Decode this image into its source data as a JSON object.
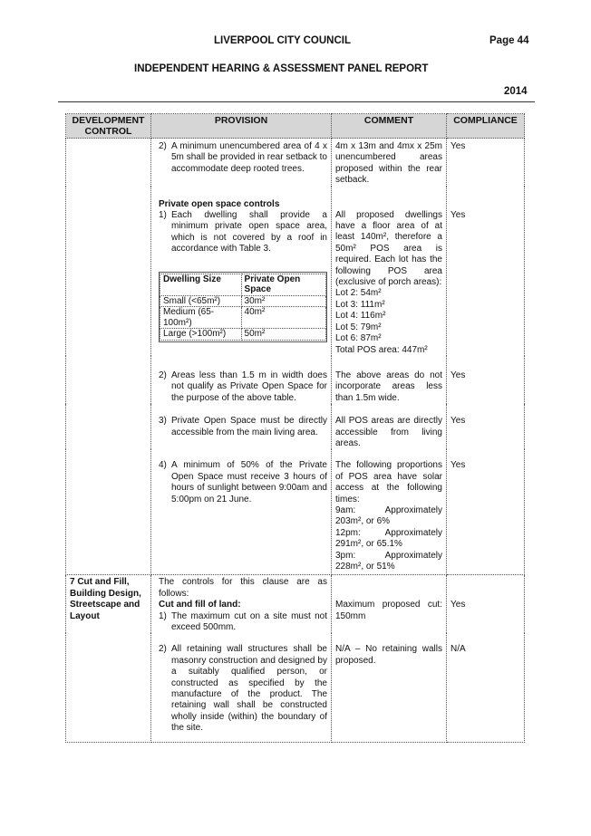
{
  "header": {
    "council": "LIVERPOOL CITY COUNCIL",
    "page": "Page 44",
    "report_title": "INDEPENDENT HEARING & ASSESSMENT PANEL REPORT",
    "year": "2014"
  },
  "table": {
    "headers": [
      "DEVELOPMENT CONTROL",
      "PROVISION",
      "COMMENT",
      "COMPLIANCE"
    ],
    "rows": {
      "r1": {
        "num": "2)",
        "provision": "A minimum unencumbered area of 4 x 5m shall be provided in rear setback to accommodate deep rooted trees.",
        "comment": "4m x 13m and 4mx x 25m unencumbered areas proposed within the rear setback.",
        "compliance": "Yes"
      },
      "r2": {
        "heading": "Private open space controls",
        "num": "1)",
        "provision": "Each dwelling shall provide a minimum private open space area, which is not covered by a roof in accordance with Table 3.",
        "comment_main": "All proposed dwellings have a floor area of at least 140m², therefore a 50m² POS area is required. Each lot has the following POS area (exclusive of porch areas):",
        "lots": [
          "Lot 2: 54m²",
          "Lot 3: 111m²",
          "Lot 4: 116m²",
          "Lot 5: 79m²",
          "Lot 6: 87m²",
          "Total POS area: 447m²"
        ],
        "compliance": "Yes",
        "pos_table": {
          "col1": "Dwelling Size",
          "col2": "Private Open Space",
          "rows": [
            {
              "size": "Small (<65m²)",
              "space": "30m²"
            },
            {
              "size": "Medium (65-100m²)",
              "space": "40m²"
            },
            {
              "size": "Large (>100m²)",
              "space": "50m²"
            }
          ]
        }
      },
      "r3": {
        "num": "2)",
        "provision": "Areas less than 1.5 m in width does not qualify as Private Open Space for the purpose of the above table.",
        "comment": "The above areas do not incorporate areas less than 1.5m wide.",
        "compliance": "Yes"
      },
      "r4": {
        "num": "3)",
        "provision": "Private Open Space must be directly accessible from the main living area.",
        "comment": "All POS areas are directly accessible from living areas.",
        "compliance": "Yes"
      },
      "r5": {
        "num": "4)",
        "provision": "A minimum of 50% of the Private Open Space must receive 3 hours of hours of sunlight between 9:00am and 5:00pm on 21 June.",
        "comment_main": "The following proportions of POS area have solar access at the following times:",
        "times": [
          {
            "t": "9am:",
            "v": "Approximately",
            "r": "203m², or 6%"
          },
          {
            "t": "12pm:",
            "v": "Approximately",
            "r": "291m², or 65.1%"
          },
          {
            "t": "3pm:",
            "v": "Approximately",
            "r": "228m², or 51%"
          }
        ],
        "compliance": "Yes"
      },
      "r6": {
        "control": "7 Cut and Fill, Building Design, Streetscape and Layout",
        "intro": "The controls for this clause are as follows:",
        "subheading": "Cut and fill of land:",
        "num": "1)",
        "provision": "The maximum cut on a site must not exceed 500mm.",
        "comment": "Maximum proposed cut: 150mm",
        "compliance": "Yes"
      },
      "r7": {
        "num": "2)",
        "provision": "All retaining wall structures shall be masonry construction and designed by a suitably qualified person, or constructed as specified by the manufacture of the product. The retaining wall shall be constructed wholly inside (within) the boundary of the site.",
        "comment": "N/A – No retaining walls proposed.",
        "compliance": "N/A"
      }
    }
  }
}
